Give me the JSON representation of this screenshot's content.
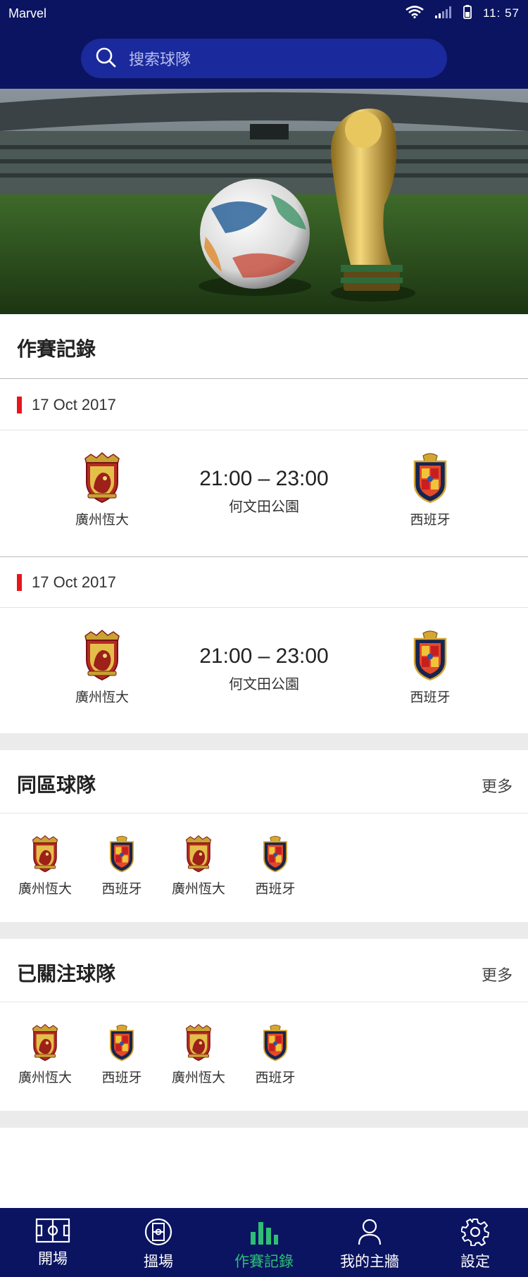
{
  "status_bar": {
    "carrier": "Marvel",
    "time": "11: 57"
  },
  "search": {
    "placeholder": "搜索球隊"
  },
  "records": {
    "title": "作賽記錄",
    "matches": [
      {
        "date": "17 Oct 2017",
        "home": "廣州恆大",
        "away": "西班牙",
        "time": "21:00 – 23:00",
        "venue": "何文田公園"
      },
      {
        "date": "17 Oct 2017",
        "home": "廣州恆大",
        "away": "西班牙",
        "time": "21:00 – 23:00",
        "venue": "何文田公園"
      }
    ]
  },
  "nearby": {
    "title": "同區球隊",
    "more": "更多",
    "teams": [
      "廣州恆大",
      "西班牙",
      "廣州恆大",
      "西班牙"
    ]
  },
  "followed": {
    "title": "已關注球隊",
    "more": "更多",
    "teams": [
      "廣州恆大",
      "西班牙",
      "廣州恆大",
      "西班牙"
    ]
  },
  "tabbar": {
    "items": [
      {
        "label": "開場",
        "icon": "pitch-icon"
      },
      {
        "label": "搵場",
        "icon": "stadium-icon"
      },
      {
        "label": "作賽記錄",
        "icon": "bar-chart-icon"
      },
      {
        "label": "我的主牆",
        "icon": "user-icon"
      },
      {
        "label": "設定",
        "icon": "gear-icon"
      }
    ],
    "active_index": 2
  },
  "colors": {
    "navy": "#0b1461",
    "accent_green": "#2dbf76",
    "date_red": "#e8161b"
  }
}
